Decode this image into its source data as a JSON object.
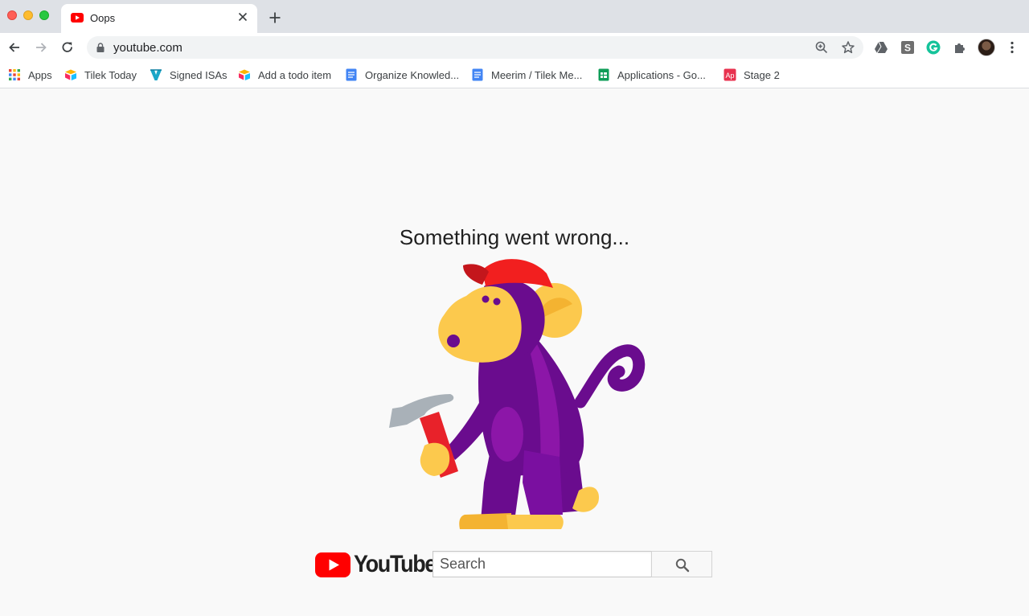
{
  "browser": {
    "tab": {
      "title": "Oops",
      "favicon": "youtube-icon"
    },
    "address_bar": {
      "url": "youtube.com"
    },
    "bookmarks": [
      {
        "label": "Apps",
        "icon": "apps-grid-icon"
      },
      {
        "label": "Tilek Today",
        "icon": "airtable-icon"
      },
      {
        "label": "Signed ISAs",
        "icon": "v-logo-icon"
      },
      {
        "label": "Add a todo item",
        "icon": "airtable-icon"
      },
      {
        "label": "Organize Knowled...",
        "icon": "google-docs-icon"
      },
      {
        "label": "Meerim / Tilek Me...",
        "icon": "google-docs-icon"
      },
      {
        "label": "Applications - Go...",
        "icon": "google-sheets-icon"
      },
      {
        "label": "Stage 2",
        "icon": "ap-icon"
      }
    ],
    "extensions": [
      "google-drive-icon",
      "s-extension-icon",
      "grammarly-icon",
      "puzzle-icon"
    ]
  },
  "page": {
    "error_title": "Something went wrong...",
    "logo_text": "YouTube",
    "search": {
      "placeholder": "Search",
      "value": ""
    }
  },
  "colors": {
    "youtube_red": "#ff0000",
    "monkey_purple": "#6a0c8e",
    "monkey_face": "#fcc94d",
    "hat_red": "#f21f1f"
  }
}
